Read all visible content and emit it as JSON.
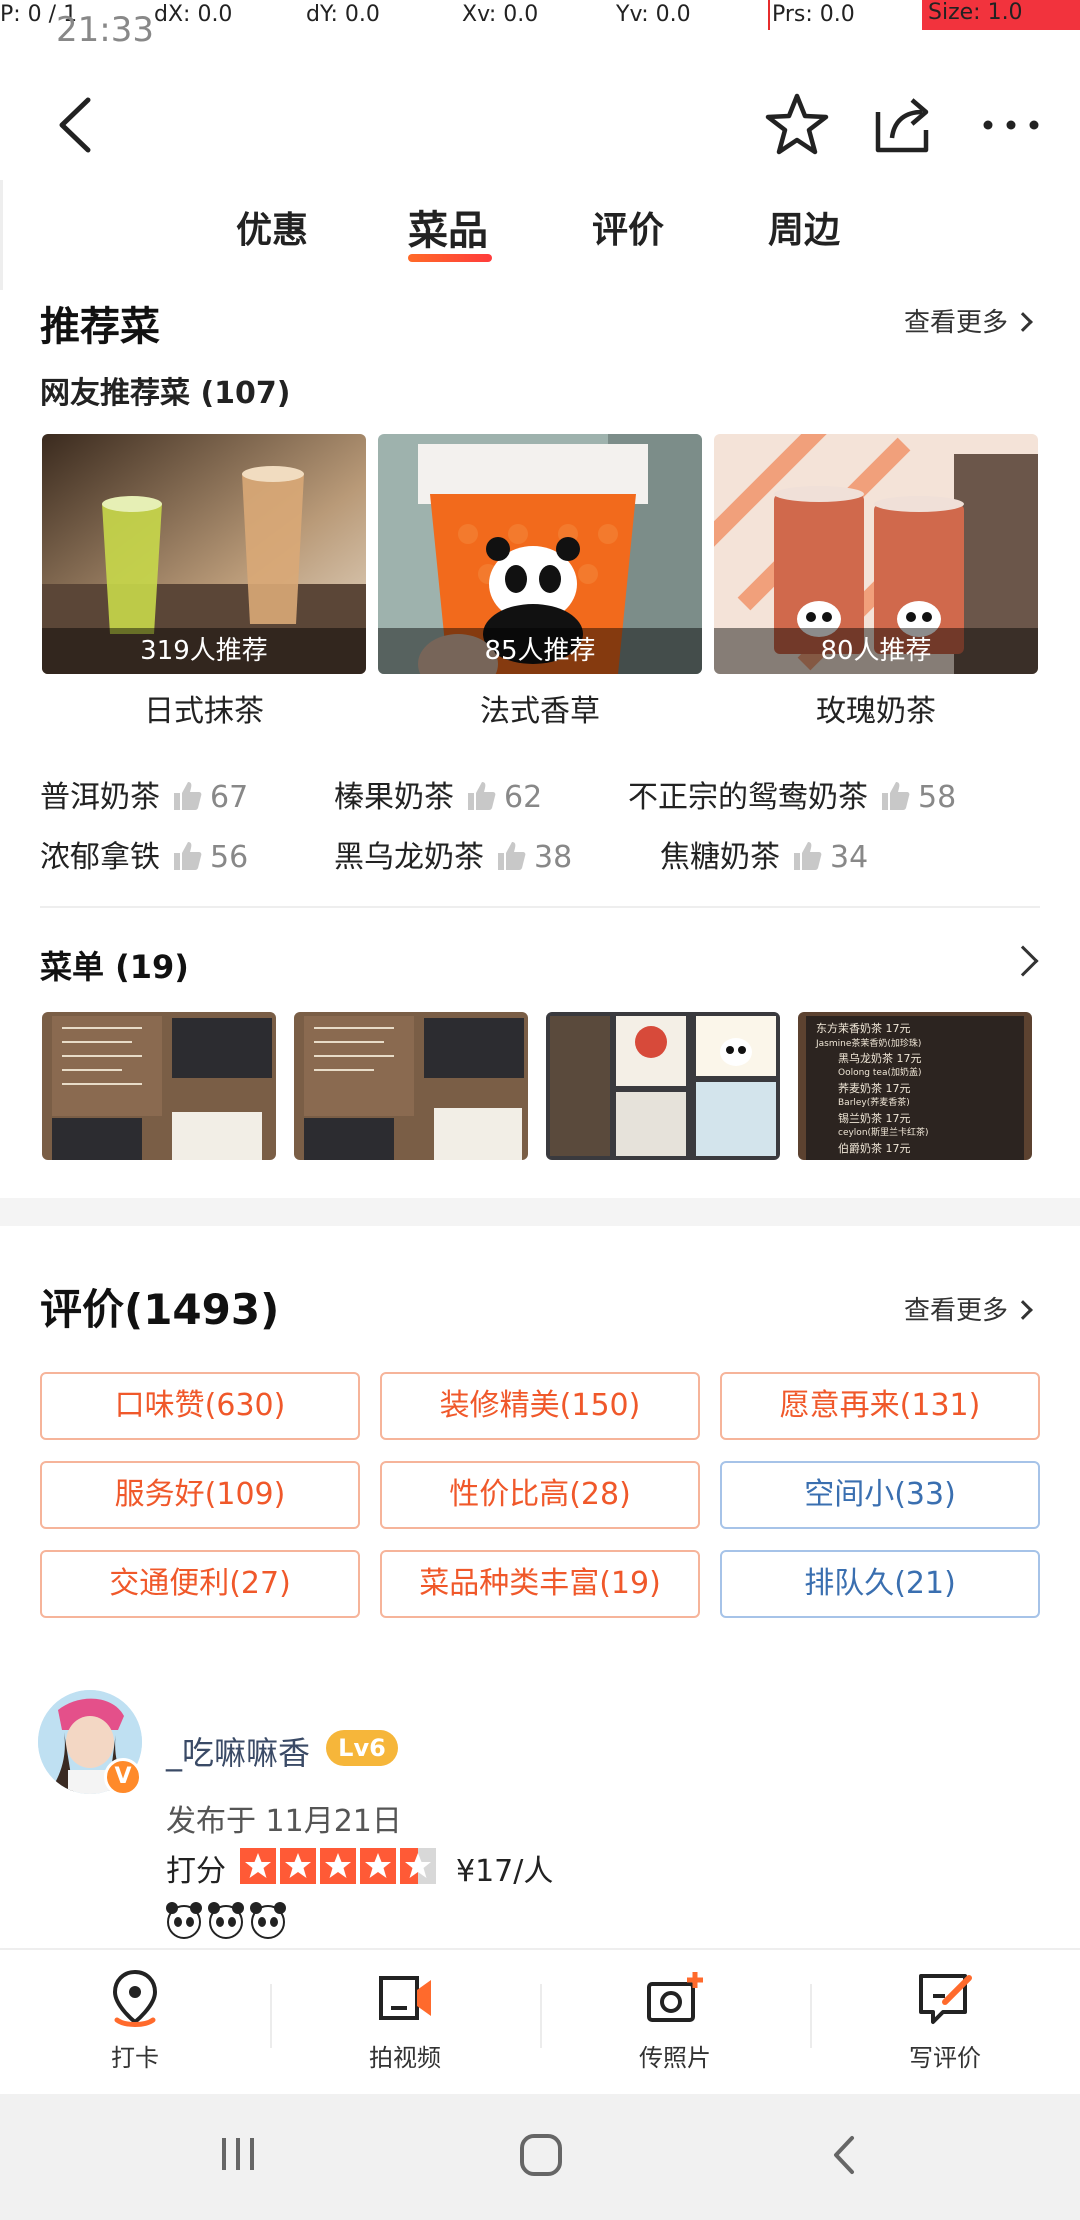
{
  "debug": {
    "p": "P: 0 / 1",
    "dx": "dX: 0.0",
    "dy": "dY: 0.0",
    "xv": "Xv: 0.0",
    "yv": "Yv: 0.0",
    "prs": "Prs: 0.0",
    "size": "Size: 1.0",
    "time": "21:33"
  },
  "tabs": [
    "优惠",
    "菜品",
    "评价",
    "周边"
  ],
  "recommend": {
    "title": "推荐菜",
    "see_more": "查看更多",
    "subtitle": "网友推荐菜 (107)",
    "cards": [
      {
        "count": "319人推荐",
        "name": "日式抹茶"
      },
      {
        "count": "85人推荐",
        "name": "法式香草"
      },
      {
        "count": "80人推荐",
        "name": "玫瑰奶茶"
      }
    ],
    "list": [
      {
        "name": "普洱奶茶",
        "num": "67"
      },
      {
        "name": "榛果奶茶",
        "num": "62"
      },
      {
        "name": "不正宗的鸳鸯奶茶",
        "num": "58"
      },
      {
        "name": "浓郁拿铁",
        "num": "56"
      },
      {
        "name": "黑乌龙奶茶",
        "num": "38"
      },
      {
        "name": "焦糖奶茶",
        "num": "34"
      }
    ]
  },
  "menu": {
    "title": "菜单 (19)",
    "photo4_lines": [
      "东方茉香奶茶 17元",
      "Jasmine茶茉香奶(加珍珠)",
      "黑乌龙奶茶 17元",
      "Oolong tea(加奶盖)",
      "荞麦奶茶 17元",
      "Barley(荞麦香茶)",
      "锡兰奶茶 17元",
      "ceylon(斯里兰卡红茶)",
      "伯爵奶茶 17元"
    ]
  },
  "reviews": {
    "title": "评价(1493)",
    "see_more": "查看更多",
    "tags": [
      {
        "label": "口味赞(630)",
        "neg": false
      },
      {
        "label": "装修精美(150)",
        "neg": false
      },
      {
        "label": "愿意再来(131)",
        "neg": false
      },
      {
        "label": "服务好(109)",
        "neg": false
      },
      {
        "label": "性价比高(28)",
        "neg": false
      },
      {
        "label": "空间小(33)",
        "neg": true
      },
      {
        "label": "交通便利(27)",
        "neg": false
      },
      {
        "label": "菜品种类丰富(19)",
        "neg": false
      },
      {
        "label": "排队久(21)",
        "neg": true
      }
    ],
    "first": {
      "username": "_吃嘛嘛香",
      "level": "Lv6",
      "vbadge": "V",
      "posted": "发布于 11月21日",
      "score_label": "打分",
      "rating": 4.5,
      "price": "¥17/人"
    }
  },
  "actions": [
    "打卡",
    "拍视频",
    "传照片",
    "写评价"
  ],
  "colors": {
    "accent": "#f0582a",
    "negative": "#3a6fb0",
    "star": "#ff5a36"
  }
}
